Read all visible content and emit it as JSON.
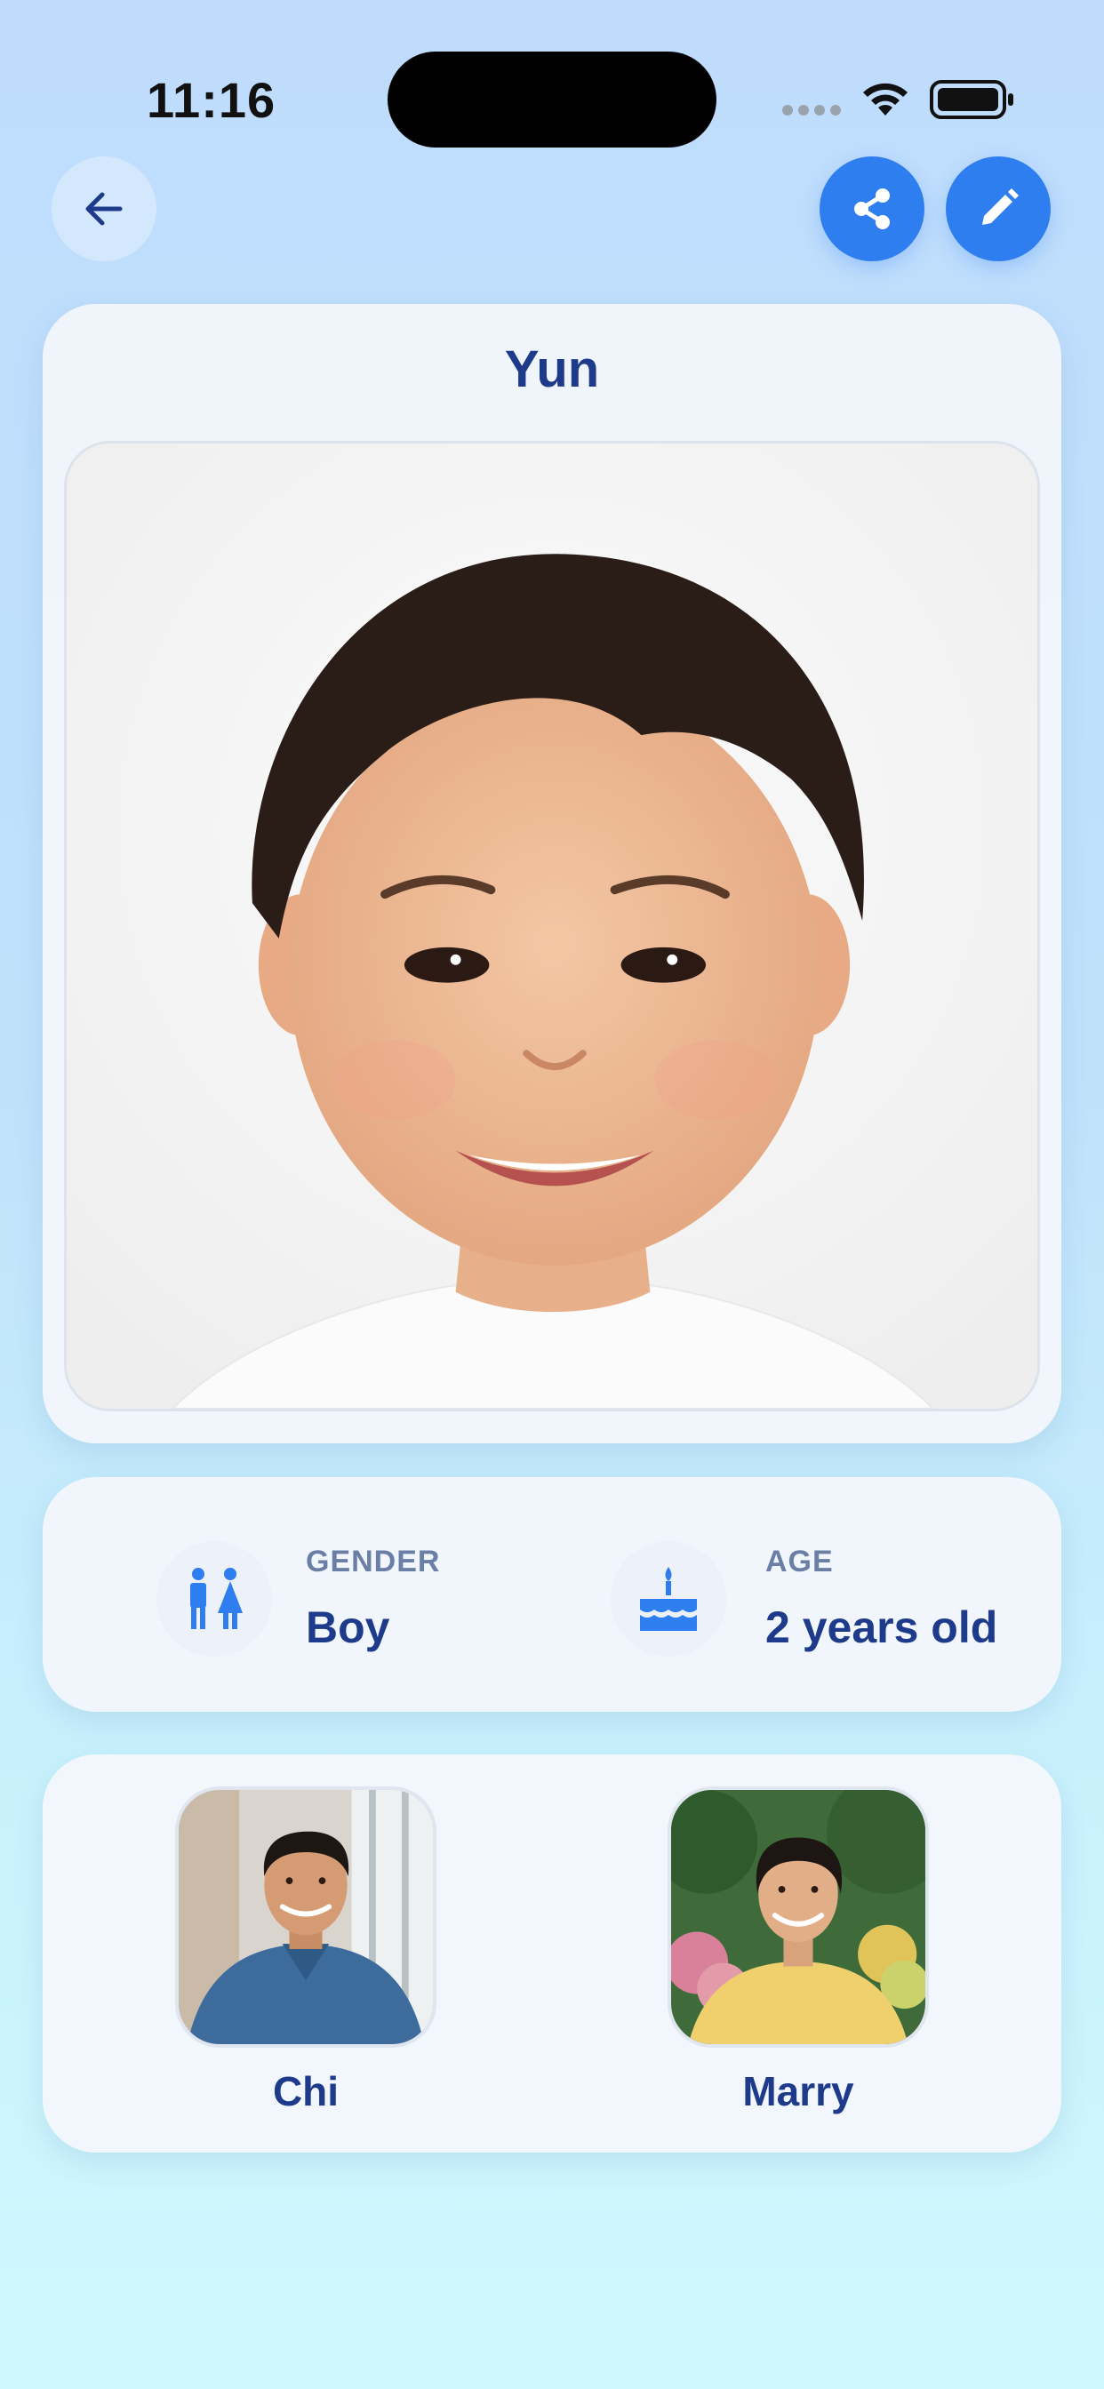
{
  "status_bar": {
    "time": "11:16"
  },
  "nav": {
    "back_icon": "arrow-left-icon",
    "share_icon": "share-icon",
    "edit_icon": "pencil-icon"
  },
  "profile": {
    "name": "Yun",
    "photo_alt": "child-portrait"
  },
  "info": {
    "gender": {
      "label": "GENDER",
      "value": "Boy",
      "icon": "restroom-icon"
    },
    "age": {
      "label": "AGE",
      "value": "2 years old",
      "icon": "birthday-cake-icon"
    }
  },
  "parents": [
    {
      "name": "Chi"
    },
    {
      "name": "Marry"
    }
  ],
  "colors": {
    "accent": "#2f7ef0",
    "text_primary": "#1e3a8a",
    "label_gray": "#6b7fa6",
    "bg_top": "#bfdcfd",
    "bg_bottom": "#cff8fe"
  }
}
